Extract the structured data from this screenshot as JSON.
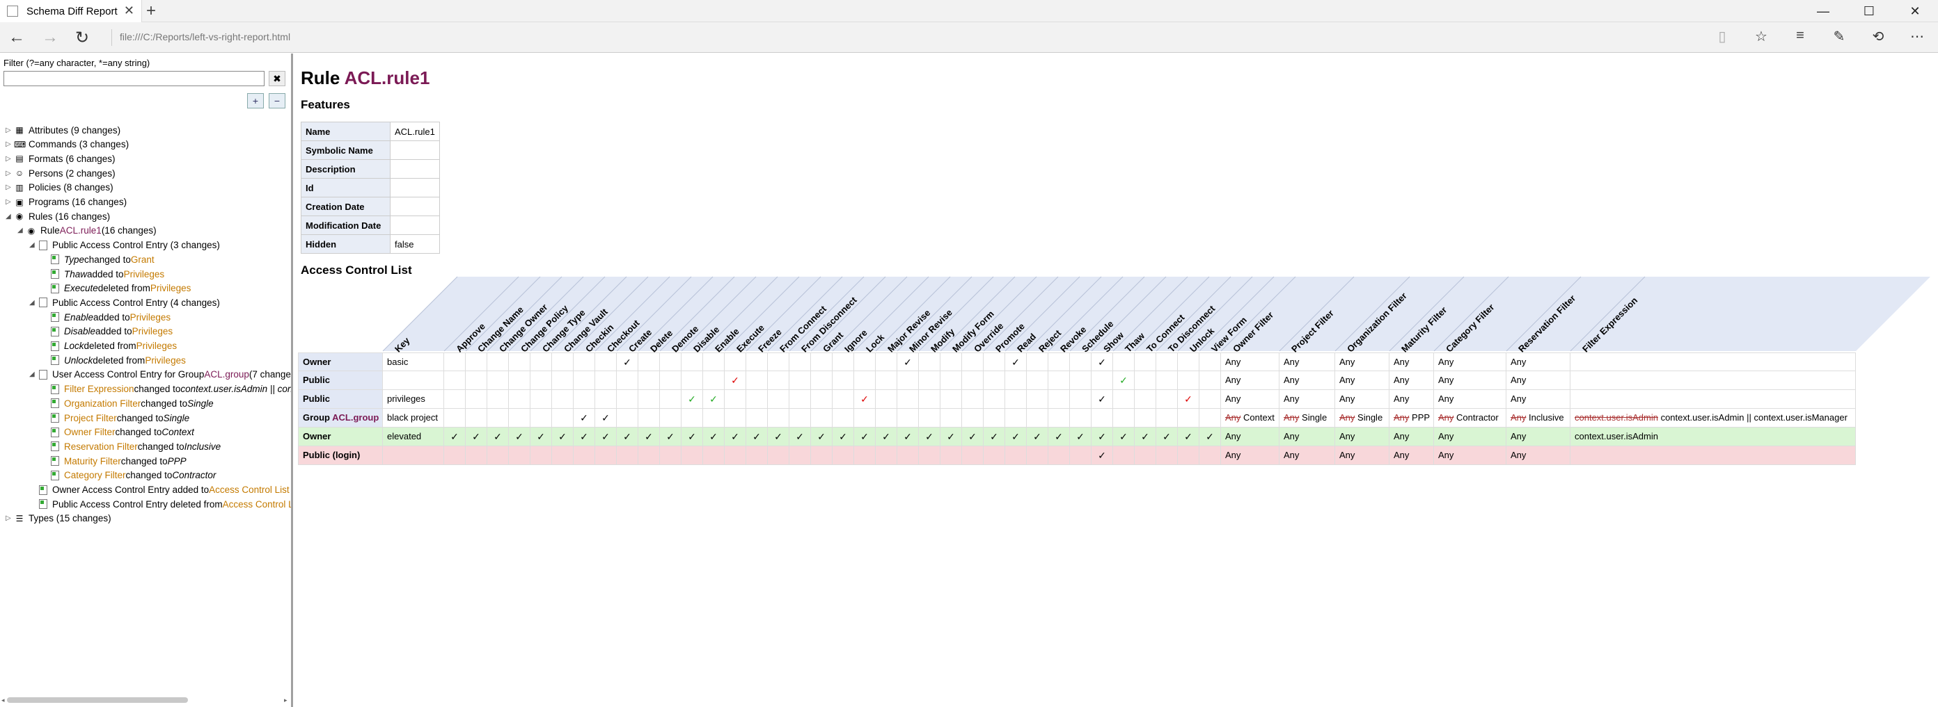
{
  "browser": {
    "tab_title": "Schema Diff Report",
    "tab_close": "✕",
    "new_tab": "+",
    "minimize": "—",
    "maximize": "☐",
    "close": "✕",
    "back": "←",
    "forward": "→",
    "refresh": "↻",
    "url": "file:///C:/Reports/left-vs-right-report.html",
    "icons": [
      "reading-view-icon",
      "favorite-star-icon",
      "hub-icon",
      "web-note-icon",
      "share-icon",
      "more-icon"
    ]
  },
  "sidebar": {
    "filter_label": "Filter (?=any character, *=any string)",
    "filter_value": "",
    "clear_label": "✖",
    "expand_all": "+",
    "collapse_all": "−",
    "tree": [
      {
        "id": "attributes",
        "label": "Attributes (9 changes)",
        "icon": "▦",
        "level": 0,
        "toggle": "▷"
      },
      {
        "id": "commands",
        "label": "Commands (3 changes)",
        "icon": "⌨",
        "level": 0,
        "toggle": "▷"
      },
      {
        "id": "formats",
        "label": "Formats (6 changes)",
        "icon": "▤",
        "level": 0,
        "toggle": "▷"
      },
      {
        "id": "persons",
        "label": "Persons (2 changes)",
        "icon": "☺",
        "level": 0,
        "toggle": "▷"
      },
      {
        "id": "policies",
        "label": "Policies (8 changes)",
        "icon": "▥",
        "level": 0,
        "toggle": "▷"
      },
      {
        "id": "programs",
        "label": "Programs (16 changes)",
        "icon": "▣",
        "level": 0,
        "toggle": "▷"
      },
      {
        "id": "rules",
        "label": "Rules (16 changes)",
        "icon": "◉",
        "level": 0,
        "toggle": "◢"
      }
    ],
    "rule_node": {
      "prefix": "Rule ",
      "name": "ACL.rule1",
      "suffix": " (16 changes)"
    },
    "entry1": "Public Access Control Entry (3 changes)",
    "entry1_items": [
      {
        "a": "Type",
        "b": " changed to ",
        "c": "Grant"
      },
      {
        "a": "Thaw",
        "b": " added to ",
        "c": "Privileges"
      },
      {
        "a": "Execute",
        "b": " deleted from ",
        "c": "Privileges"
      }
    ],
    "entry2": "Public Access Control Entry (4 changes)",
    "entry2_items": [
      {
        "a": "Enable",
        "b": " added to ",
        "c": "Privileges"
      },
      {
        "a": "Disable",
        "b": " added to ",
        "c": "Privileges"
      },
      {
        "a": "Lock",
        "b": " deleted from ",
        "c": "Privileges"
      },
      {
        "a": "Unlock",
        "b": " deleted from ",
        "c": "Privileges"
      }
    ],
    "entry3_prefix": "User Access Control Entry for Group ",
    "entry3_group": "ACL.group",
    "entry3_suffix": " (7 change",
    "entry3_items": [
      {
        "a": "Filter Expression",
        "b": " changed to ",
        "c": "context.user.isAdmin || conte"
      },
      {
        "a": "Organization Filter",
        "b": " changed to ",
        "c": "Single"
      },
      {
        "a": "Project Filter",
        "b": " changed to ",
        "c": "Single"
      },
      {
        "a": "Owner Filter",
        "b": " changed to ",
        "c": "Context"
      },
      {
        "a": "Reservation Filter",
        "b": " changed to ",
        "c": "Inclusive"
      },
      {
        "a": "Maturity Filter",
        "b": " changed to ",
        "c": "PPP"
      },
      {
        "a": "Category Filter",
        "b": " changed to ",
        "c": "Contractor"
      }
    ],
    "entry4_prefix": "Owner Access Control Entry added to ",
    "entry4_target": "Access Control List",
    "entry5_prefix": "Public Access Control Entry deleted from ",
    "entry5_target": "Access Control Li",
    "types": "Types (15 changes)",
    "types_icon": "☰",
    "scroll_left": "◂",
    "scroll_right": "▸"
  },
  "main": {
    "title_prefix": "Rule ",
    "title_name": "ACL.rule1",
    "features_heading": "Features",
    "features": [
      {
        "k": "Name",
        "v": "ACL.rule1"
      },
      {
        "k": "Symbolic Name",
        "v": ""
      },
      {
        "k": "Description",
        "v": ""
      },
      {
        "k": "Id",
        "v": ""
      },
      {
        "k": "Creation Date",
        "v": ""
      },
      {
        "k": "Modification Date",
        "v": ""
      },
      {
        "k": "Hidden",
        "v": "false"
      }
    ],
    "acl_heading": "Access Control List",
    "columns": [
      "Key",
      "Approve",
      "Change Name",
      "Change Owner",
      "Change Policy",
      "Change Type",
      "Change Vault",
      "Checkin",
      "Checkout",
      "Create",
      "Delete",
      "Demote",
      "Disable",
      "Enable",
      "Execute",
      "Freeze",
      "From Connect",
      "From Disconnect",
      "Grant",
      "Ignore",
      "Lock",
      "Major Revise",
      "Minor Revise",
      "Modify",
      "Modify Form",
      "Override",
      "Promote",
      "Read",
      "Reject",
      "Revoke",
      "Schedule",
      "Show",
      "Thaw",
      "To Connect",
      "To Disconnect",
      "Unlock",
      "View Form",
      "Owner Filter",
      "Project Filter",
      "Organization Filter",
      "Maturity Filter",
      "Category Filter",
      "Reservation Filter",
      "Filter Expression"
    ],
    "rows": [
      {
        "who": "Owner",
        "key": "basic",
        "checks": {
          "Create": "b",
          "Minor Revise": "b",
          "Read": "b",
          "Show": "b"
        },
        "filters": [
          "Any",
          "Any",
          "Any",
          "Any",
          "Any",
          "Any",
          ""
        ],
        "style": "plain"
      },
      {
        "who": "Public",
        "key": "",
        "checks": {
          "Execute": "r",
          "Thaw": "g"
        },
        "filters": [
          "Any",
          "Any",
          "Any",
          "Any",
          "Any",
          "Any",
          ""
        ],
        "style": "plain"
      },
      {
        "who": "Public",
        "key": "privileges",
        "checks": {
          "Disable": "g",
          "Enable": "g",
          "Lock": "r",
          "Show": "b",
          "Unlock": "r"
        },
        "filters": [
          "Any",
          "Any",
          "Any",
          "Any",
          "Any",
          "Any",
          ""
        ],
        "style": "plain"
      },
      {
        "who": "Group ",
        "who_group": "ACL.group",
        "key": "black project",
        "checks": {
          "Checkin": "b",
          "Checkout": "b"
        },
        "filters": [
          "Any",
          "Any",
          "Any",
          "Any",
          "Any",
          "Any",
          ""
        ],
        "filters_new": [
          "Context",
          "Single",
          "Single",
          "PPP",
          "Contractor",
          "Inclusive",
          "context.user.isAdmin || context.user.isManager"
        ],
        "filters_old": [
          "Any",
          "Any",
          "Any",
          "Any",
          "Any",
          "Any",
          "context.user.isAdmin"
        ],
        "style": "plain"
      },
      {
        "who": "Owner",
        "key": "elevated",
        "checks": "all",
        "filters": [
          "Any",
          "Any",
          "Any",
          "Any",
          "Any",
          "Any",
          "context.user.isAdmin"
        ],
        "style": "added"
      },
      {
        "who": "Public (login)",
        "key": "",
        "checks": {
          "Show": "b"
        },
        "filters": [
          "Any",
          "Any",
          "Any",
          "Any",
          "Any",
          "Any",
          ""
        ],
        "style": "deleted"
      }
    ],
    "check_glyph": "✓",
    "colors": {
      "added": "#d9f5d3",
      "deleted": "#f8d7da",
      "header": "#e2e8f5",
      "purple": "#7b1a55",
      "orange": "#c47a00"
    }
  }
}
